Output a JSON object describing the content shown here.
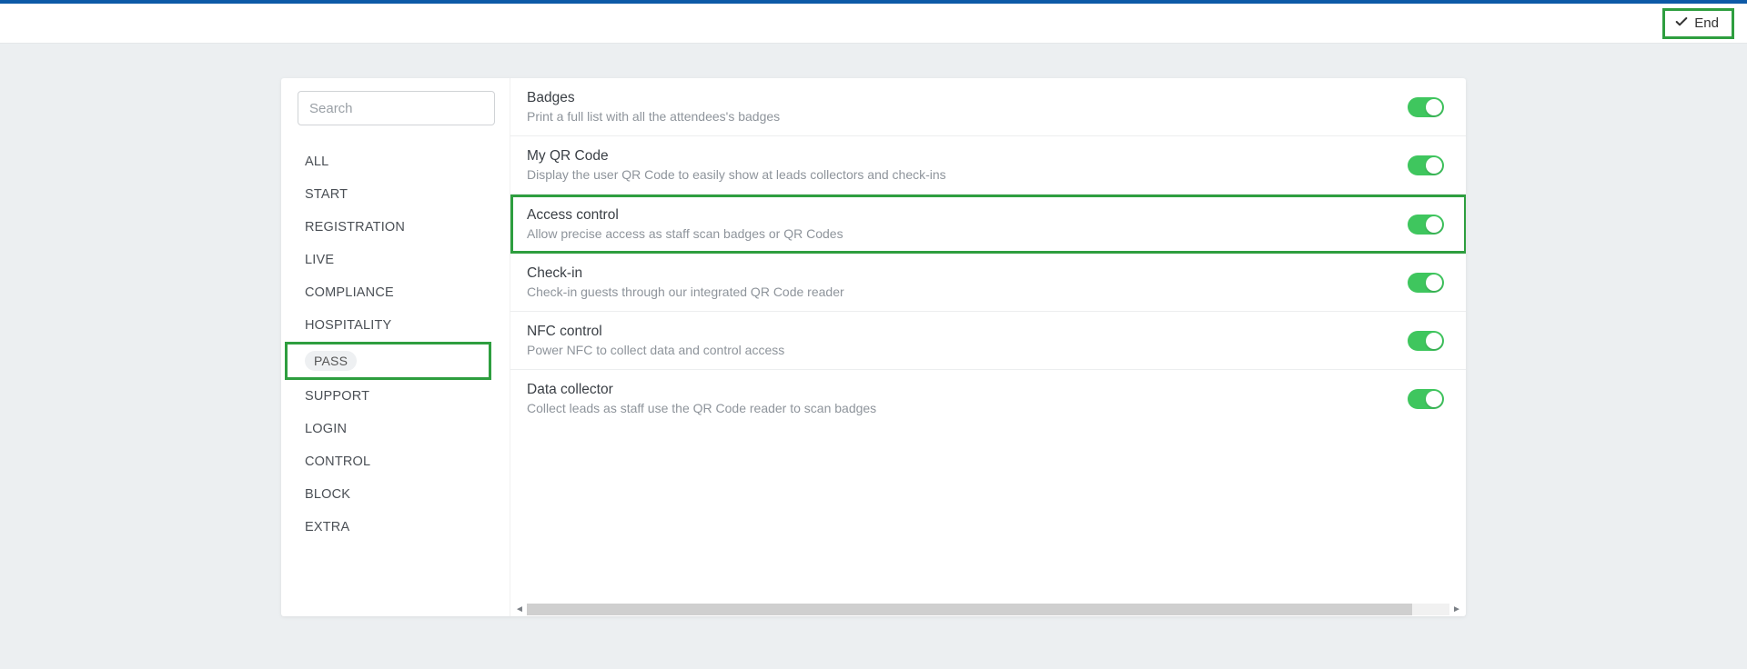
{
  "header": {
    "end_label": "End"
  },
  "sidebar": {
    "search_placeholder": "Search",
    "items": [
      {
        "label": "ALL",
        "selected": false
      },
      {
        "label": "START",
        "selected": false
      },
      {
        "label": "REGISTRATION",
        "selected": false
      },
      {
        "label": "LIVE",
        "selected": false
      },
      {
        "label": "COMPLIANCE",
        "selected": false
      },
      {
        "label": "HOSPITALITY",
        "selected": false
      },
      {
        "label": "PASS",
        "selected": true
      },
      {
        "label": "SUPPORT",
        "selected": false
      },
      {
        "label": "LOGIN",
        "selected": false
      },
      {
        "label": "CONTROL",
        "selected": false
      },
      {
        "label": "BLOCK",
        "selected": false
      },
      {
        "label": "EXTRA",
        "selected": false
      }
    ]
  },
  "settings": [
    {
      "title": "Badges",
      "desc": "Print a full list with all the attendees's badges",
      "enabled": true,
      "highlighted": false
    },
    {
      "title": "My QR Code",
      "desc": "Display the user QR Code to easily show at leads collectors and check-ins",
      "enabled": true,
      "highlighted": false
    },
    {
      "title": "Access control",
      "desc": "Allow precise access as staff scan badges or QR Codes",
      "enabled": true,
      "highlighted": true
    },
    {
      "title": "Check-in",
      "desc": "Check-in guests through our integrated QR Code reader",
      "enabled": true,
      "highlighted": false
    },
    {
      "title": "NFC control",
      "desc": "Power NFC to collect data and control access",
      "enabled": true,
      "highlighted": false
    },
    {
      "title": "Data collector",
      "desc": "Collect leads as staff use the QR Code reader to scan badges",
      "enabled": true,
      "highlighted": false
    }
  ],
  "colors": {
    "highlight_border": "#2e9e3f",
    "top_strip": "#0d5aa7",
    "toggle_on": "#3fc65e"
  }
}
